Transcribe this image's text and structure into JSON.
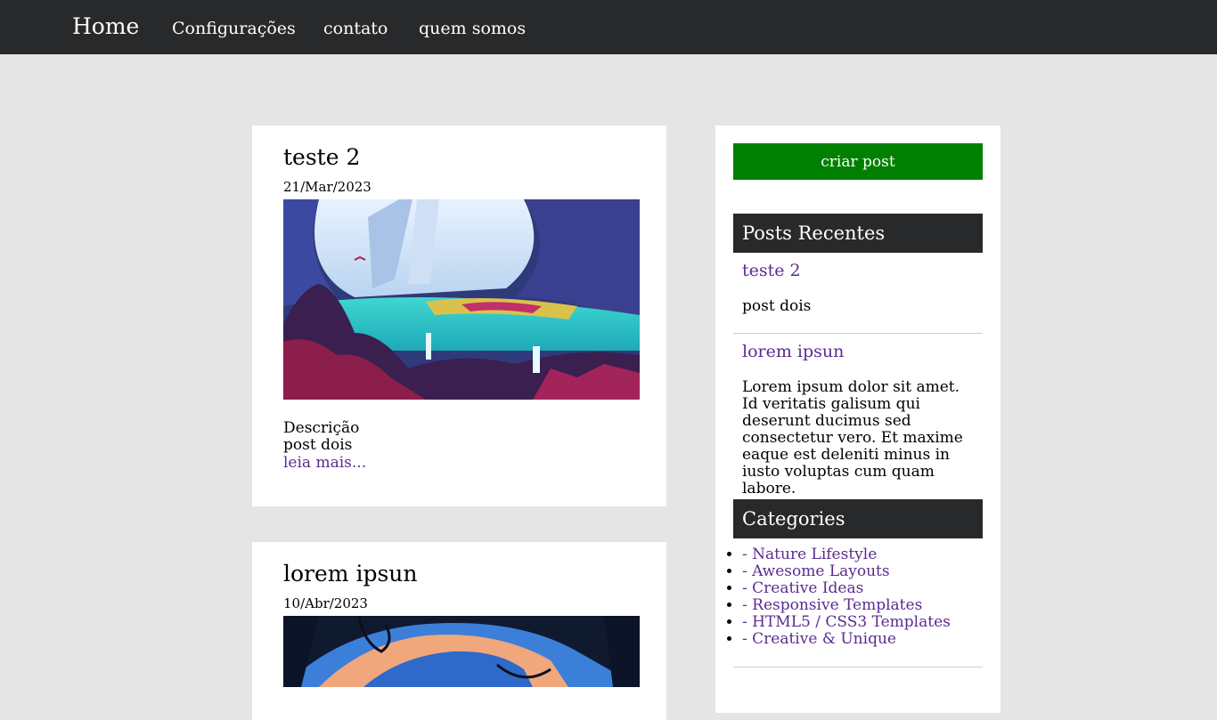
{
  "nav": {
    "home": "Home",
    "configuracoes": "Configurações",
    "contato": "contato",
    "quem_somos": "quem somos"
  },
  "posts": [
    {
      "title": "teste 2",
      "date": "21/Mar/2023",
      "description": "Descrição post dois",
      "read_more": "leia mais..."
    },
    {
      "title": "lorem ipsun",
      "date": "10/Abr/2023"
    }
  ],
  "sidebar": {
    "create_button": "criar post",
    "recent_header": "Posts Recentes",
    "recent": [
      {
        "title": "teste 2",
        "text": "post dois"
      },
      {
        "title": "lorem ipsun",
        "text": "Lorem ipsum dolor sit amet. Id veritatis galisum qui deserunt ducimus sed consectetur vero. Et maxime eaque est deleniti minus in iusto voluptas cum quam labore."
      }
    ],
    "categories_header": "Categories",
    "categories": [
      "- Nature Lifestyle",
      "- Awesome Layouts",
      "- Creative Ideas",
      "- Responsive Templates",
      "- HTML5 / CSS3 Templates",
      "- Creative & Unique"
    ]
  },
  "colors": {
    "navbar": "#28292b",
    "page_bg": "#e5e5e5",
    "button_green": "#008000",
    "link_purple": "#5b2b91"
  }
}
